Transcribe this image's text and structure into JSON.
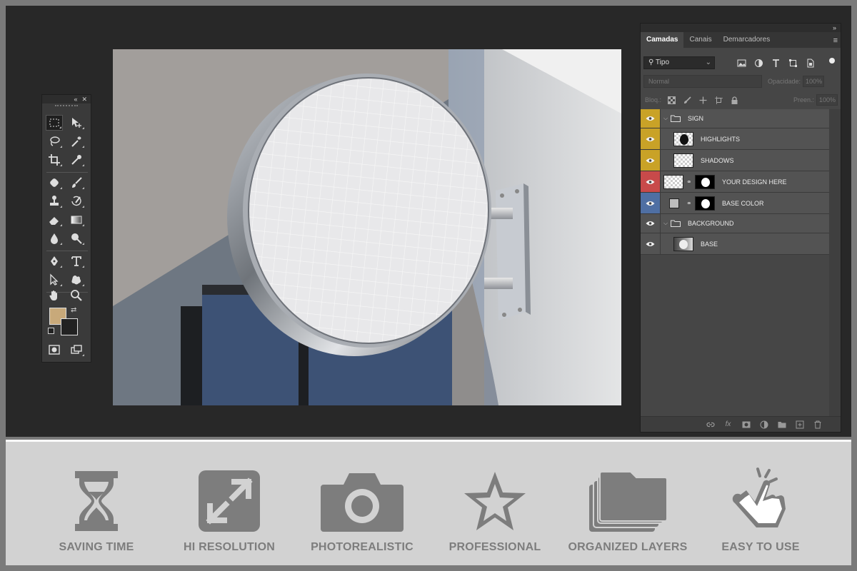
{
  "layers_panel": {
    "tabs": [
      "Camadas",
      "Canais",
      "Demarcadores"
    ],
    "filter_value": "Tipo",
    "blend_mode": "Normal",
    "opacity_label": "Opacidade:",
    "opacity_value": "100%",
    "lock_label": "Bloq.:",
    "fill_label": "Preen.:",
    "fill_value": "100%",
    "fx_label": "fx",
    "layers": [
      {
        "name": "SIGN",
        "eye_color": "#c9a227"
      },
      {
        "name": "HIGHLIGHTS",
        "eye_color": "#c9a227"
      },
      {
        "name": "SHADOWS",
        "eye_color": "#c9a227"
      },
      {
        "name": "YOUR DESIGN HERE",
        "eye_color": "#c84a4a"
      },
      {
        "name": "BASE COLOR",
        "eye_color": "#4f6fa3"
      },
      {
        "name": "BACKGROUND",
        "eye_color": "#535353"
      },
      {
        "name": "BASE",
        "eye_color": "#535353"
      }
    ]
  },
  "toolbar": {
    "foreground_color": "#c8a97a",
    "background_color": "#222222",
    "tools": [
      "marquee-icon",
      "move-icon",
      "lasso-icon",
      "magic-wand-icon",
      "crop-icon",
      "eyedropper-icon",
      "healing-icon",
      "brush-icon",
      "stamp-icon",
      "history-brush-icon",
      "eraser-icon",
      "gradient-icon",
      "blur-icon",
      "dodge-icon",
      "pen-icon",
      "type-icon",
      "path-select-icon",
      "shape-icon",
      "hand-icon",
      "zoom-icon",
      "quick-mask-icon",
      "screen-mode-icon"
    ]
  },
  "features": [
    {
      "label": "SAVING TIME",
      "icon": "hourglass-icon"
    },
    {
      "label": "HI RESOLUTION",
      "icon": "expand-icon"
    },
    {
      "label": "PHOTOREALISTIC",
      "icon": "camera-icon"
    },
    {
      "label": "PROFESSIONAL",
      "icon": "star-icon"
    },
    {
      "label": "ORGANIZED LAYERS",
      "icon": "layers-icon"
    },
    {
      "label": "EASY TO USE",
      "icon": "tap-hand-icon"
    }
  ],
  "colors": {
    "workspace": "#282828",
    "panel": "#464646",
    "feature_strip": "#d2d2d2",
    "feature_text": "#7d7d7d"
  }
}
